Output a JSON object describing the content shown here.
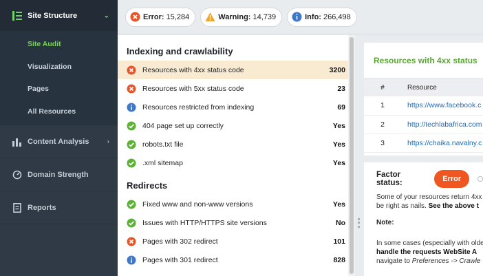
{
  "sidebar": {
    "sections": [
      {
        "label": "Site Structure",
        "icon": "site-structure-icon",
        "active": true
      },
      {
        "label": "Content Analysis",
        "icon": "content-analysis-icon"
      },
      {
        "label": "Domain Strength",
        "icon": "domain-strength-icon"
      },
      {
        "label": "Reports",
        "icon": "reports-icon"
      }
    ],
    "sub_items": [
      {
        "label": "Site Audit",
        "active": true
      },
      {
        "label": "Visualization"
      },
      {
        "label": "Pages"
      },
      {
        "label": "All Resources"
      }
    ]
  },
  "summary": {
    "error_label": "Error:",
    "error_count": "15,284",
    "warning_label": "Warning:",
    "warning_count": "14,739",
    "info_label": "Info:",
    "info_count": "266,498"
  },
  "groups": [
    {
      "title": "Indexing and crawlability",
      "rows": [
        {
          "status": "error",
          "label": "Resources with 4xx status code",
          "value": "3200",
          "selected": true
        },
        {
          "status": "error",
          "label": "Resources with 5xx status code",
          "value": "23"
        },
        {
          "status": "info",
          "label": "Resources restricted from indexing",
          "value": "69"
        },
        {
          "status": "ok",
          "label": "404 page set up correctly",
          "value": "Yes"
        },
        {
          "status": "ok",
          "label": "robots.txt file",
          "value": "Yes"
        },
        {
          "status": "ok",
          "label": ".xml sitemap",
          "value": "Yes"
        }
      ]
    },
    {
      "title": "Redirects",
      "rows": [
        {
          "status": "ok",
          "label": "Fixed www and non-www versions",
          "value": "Yes"
        },
        {
          "status": "ok",
          "label": "Issues with HTTP/HTTPS site versions",
          "value": "No"
        },
        {
          "status": "error",
          "label": "Pages with 302 redirect",
          "value": "101"
        },
        {
          "status": "info",
          "label": "Pages with 301 redirect",
          "value": "828"
        }
      ]
    }
  ],
  "resources_panel": {
    "title": "Resources with 4xx status",
    "col_num": "#",
    "col_resource": "Resource",
    "rows": [
      {
        "num": "1",
        "url": "https://www.facebook.c"
      },
      {
        "num": "2",
        "url": "http://techlabafrica.com"
      },
      {
        "num": "3",
        "url": "https://chaika.navalny.c"
      }
    ]
  },
  "factor_panel": {
    "label": "Factor status:",
    "status": "Error",
    "text_line1": "Some of your resources return 4xx",
    "text_line2_a": "be right as nails. ",
    "text_line2_b": "See the above t",
    "note_label": "Note:",
    "note_line1": "In some cases (especially with olde",
    "note_line2": "handle the requests WebSite A",
    "note_line3_a": "navigate to ",
    "note_line3_b": "Preferences -> Crawle"
  },
  "colors": {
    "error": "#e5562d",
    "ok": "#5cb236",
    "info": "#3f78c8",
    "warning": "#f0a32d",
    "accent_green": "#6fd36a"
  }
}
